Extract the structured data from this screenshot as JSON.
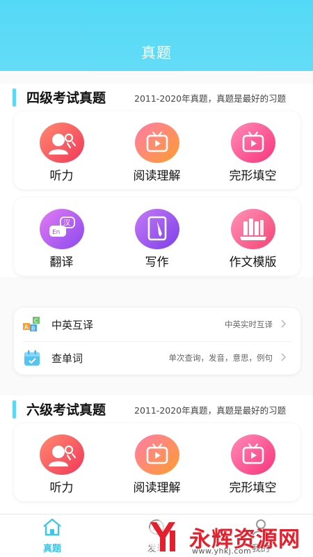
{
  "header": {
    "title": "真题"
  },
  "section_cet4": {
    "title": "四级考试真题",
    "subtitle": "2011-2020年真题，真题是最好的习题",
    "row1": [
      {
        "label": "听力",
        "icon": "listening-head-icon"
      },
      {
        "label": "阅读理解",
        "icon": "tv-play-icon"
      },
      {
        "label": "完形填空",
        "icon": "tv-play-icon"
      }
    ],
    "row2": [
      {
        "label": "翻译",
        "icon": "translate-bubble-icon"
      },
      {
        "label": "写作",
        "icon": "notebook-pen-icon"
      },
      {
        "label": "作文模版",
        "icon": "bookshelf-icon"
      }
    ]
  },
  "tools": [
    {
      "label": "中英互译",
      "desc": "中英实时互译",
      "icon": "abc-blocks-icon"
    },
    {
      "label": "查单词",
      "desc": "单次查询，发音，意思，例句",
      "icon": "calendar-icon"
    }
  ],
  "section_cet6": {
    "title": "六级考试真题",
    "subtitle": "2011-2020年真题，真题是最好的习题",
    "row1": [
      {
        "label": "听力",
        "icon": "listening-head-icon"
      },
      {
        "label": "阅读理解",
        "icon": "tv-play-icon"
      },
      {
        "label": "完形填空",
        "icon": "tv-play-icon"
      }
    ]
  },
  "tabbar": [
    {
      "label": "真题",
      "icon": "home-icon",
      "active": true
    },
    {
      "label": "发现",
      "icon": "discover-icon",
      "active": false
    },
    {
      "label": "我的",
      "icon": "profile-icon",
      "active": false
    }
  ],
  "watermark": {
    "text": "永辉资源网",
    "url": "www.yhkj.com"
  },
  "colors": {
    "accent": "#53d9f6",
    "active_tab": "#3cc7ea",
    "watermark_red": "#e3202d"
  }
}
